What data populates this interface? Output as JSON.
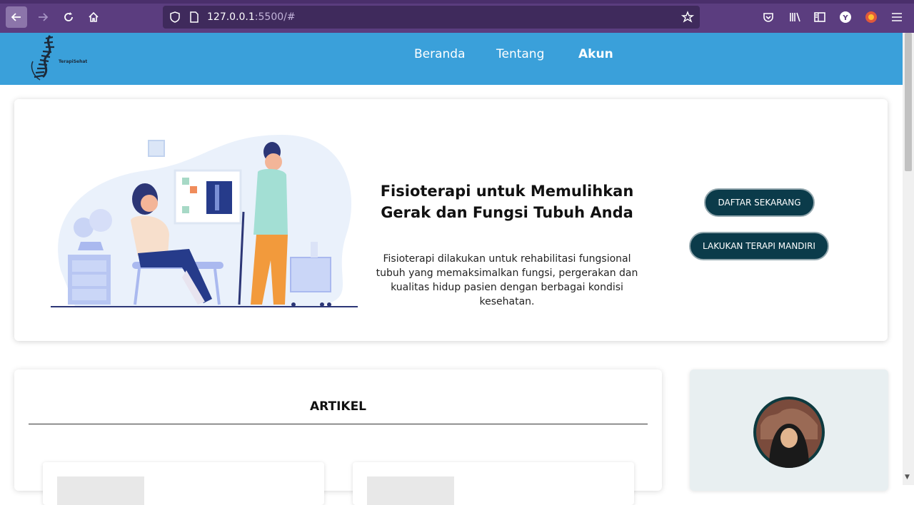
{
  "browser": {
    "url_host": "127.0.0.1",
    "url_rest": ":5500/#"
  },
  "nav": {
    "logo_text": "TerapiSehat",
    "links": [
      "Beranda",
      "Tentang",
      "Akun"
    ]
  },
  "hero": {
    "title": "Fisioterapi untuk Memulihkan Gerak dan Fungsi Tubuh Anda",
    "description": "Fisioterapi dilakukan untuk rehabilitasi fungsional tubuh yang memaksimalkan fungsi, pergerakan dan kualitas hidup pasien dengan berbagai kondisi kesehatan.",
    "buttons": [
      "DAFTAR SEKARANG",
      "LAKUKAN TERAPI MANDIRI"
    ]
  },
  "article": {
    "title": "ARTIKEL"
  },
  "colors": {
    "nav_bg": "#3aa0da",
    "browser_bg": "#5b3d7f",
    "button_bg": "#0b3b4a",
    "profile_bg": "#e8eff1"
  }
}
